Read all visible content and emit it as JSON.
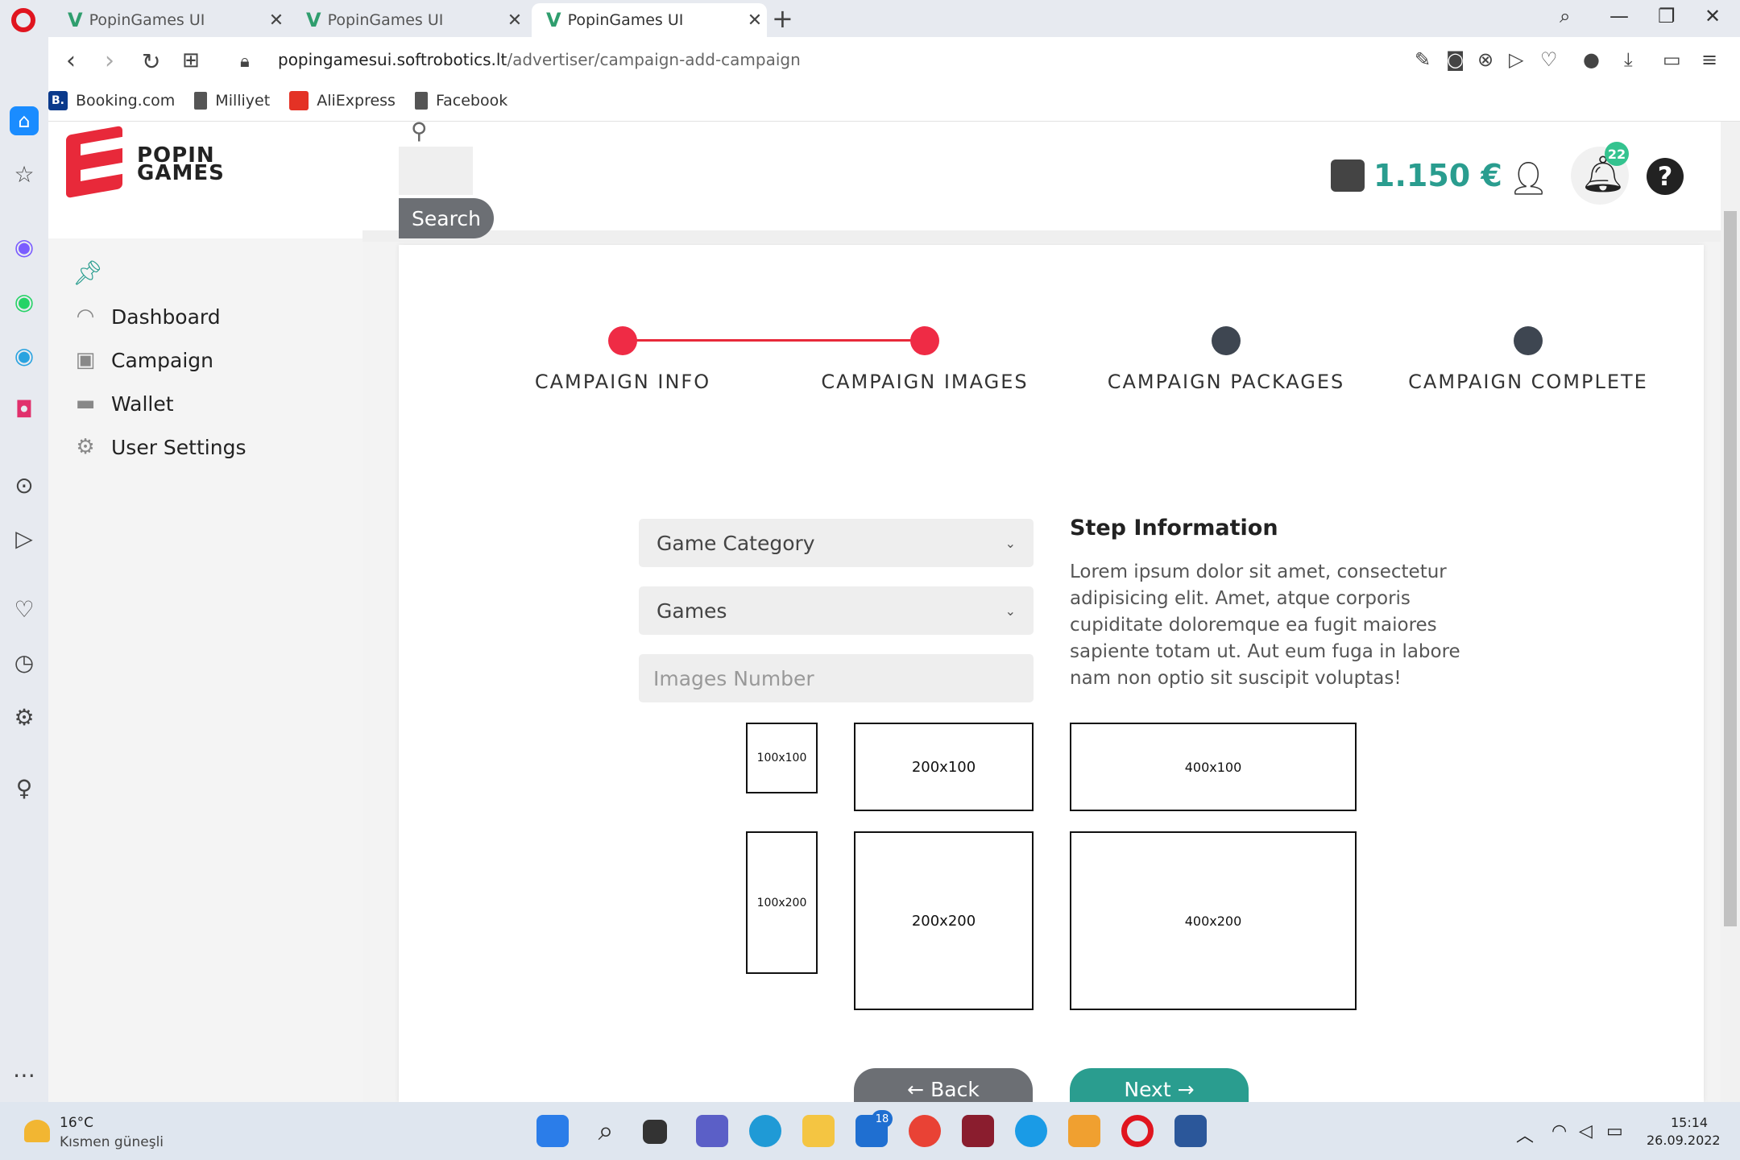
{
  "browser": {
    "tabs": [
      {
        "title": "PopinGames UI"
      },
      {
        "title": "PopinGames UI"
      },
      {
        "title": "PopinGames UI"
      }
    ],
    "url_host": "popingamesui.softrobotics.lt",
    "url_path": "/advertiser/campaign-add-campaign",
    "bookmarks": [
      {
        "label": "Booking.com",
        "badge": "B."
      },
      {
        "label": "Milliyet"
      },
      {
        "label": "AliExpress"
      },
      {
        "label": "Facebook"
      }
    ]
  },
  "app": {
    "logo_line1": "POPIN",
    "logo_line2": "GAMES",
    "sidebar": {
      "items": [
        {
          "label": "Dashboard"
        },
        {
          "label": "Campaign"
        },
        {
          "label": "Wallet"
        },
        {
          "label": "User Settings"
        }
      ]
    },
    "header": {
      "search_label": "Search",
      "balance": "1.150 €",
      "notifications": "22",
      "help": "?"
    },
    "stepper": {
      "steps": [
        {
          "label": "CAMPAIGN INFO",
          "state": "done"
        },
        {
          "label": "CAMPAIGN IMAGES",
          "state": "done"
        },
        {
          "label": "CAMPAIGN PACKAGES",
          "state": "todo"
        },
        {
          "label": "CAMPAIGN COMPLETE",
          "state": "todo"
        }
      ],
      "done_color": "#ef2b45",
      "todo_color": "#3e4651"
    },
    "form": {
      "category_value": "Game Category",
      "games_value": "Games",
      "images_placeholder": "Images Number"
    },
    "info": {
      "title": "Step Information",
      "text": "Lorem ipsum dolor sit amet, consectetur adipisicing elit. Amet, atque corporis cupiditate doloremque ea fugit maiores sapiente totam ut. Aut eum fuga in labore nam non optio sit suscipit voluptas!"
    },
    "image_sizes": [
      "100x100",
      "200x100",
      "400x100",
      "100x200",
      "200x200",
      "400x200"
    ],
    "buttons": {
      "back": "Back",
      "next": "Next"
    },
    "accent_color": "#2a9d8f"
  },
  "taskbar": {
    "weather_temp": "16°C",
    "weather_desc": "Kısmen güneşli",
    "time": "15:14",
    "date": "26.09.2022",
    "mail_badge": "18"
  }
}
